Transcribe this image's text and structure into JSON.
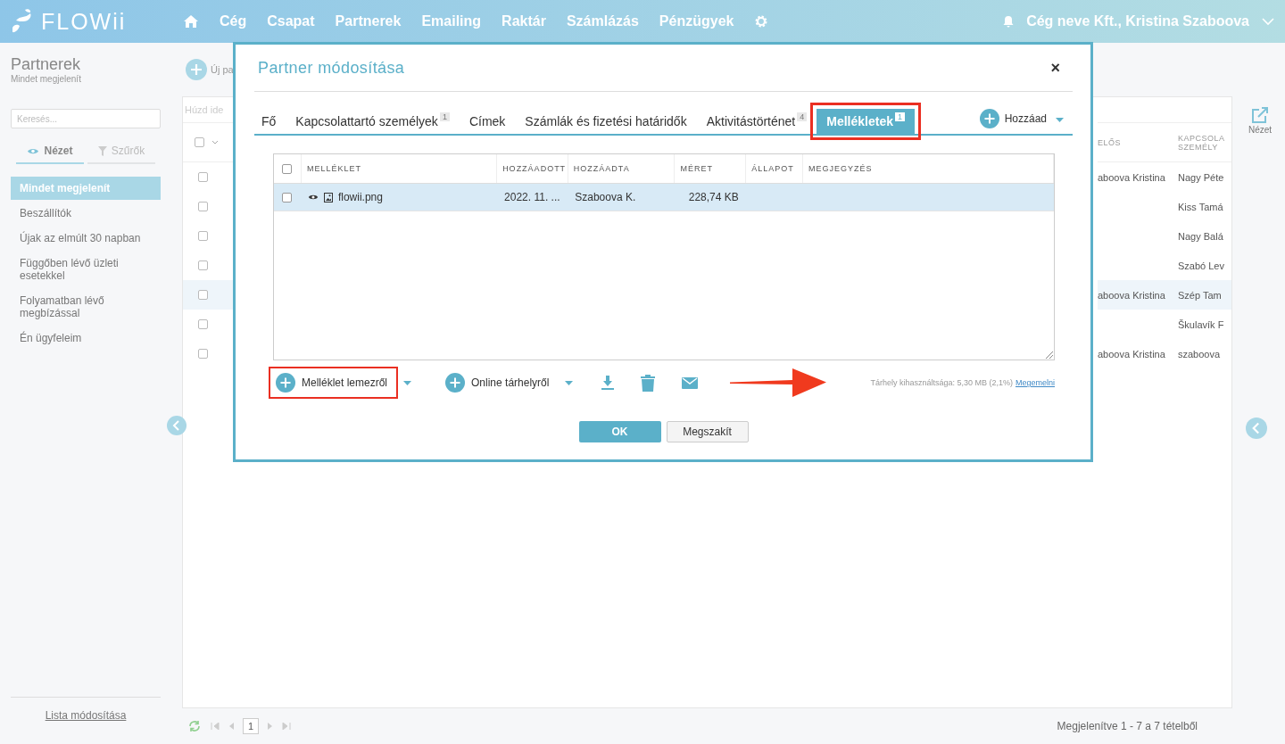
{
  "header": {
    "logo": "FLOWii",
    "nav": [
      "Cég",
      "Csapat",
      "Partnerek",
      "Emailing",
      "Raktár",
      "Számlázás",
      "Pénzügyek"
    ],
    "user": "Cég neve Kft., Kristina Szaboova"
  },
  "sidebar": {
    "title": "Partnerek",
    "subtitle": "Mindet megjelenít",
    "search": {
      "placeholder": "Keresés..."
    },
    "tabs": [
      {
        "label": "Nézet",
        "kind": "view",
        "selected": true
      },
      {
        "label": "Szűrők",
        "kind": "filter",
        "selected": false
      }
    ],
    "items": [
      {
        "label": "Mindet megjelenít",
        "selected": true
      },
      {
        "label": "Beszállítók",
        "selected": false
      },
      {
        "label": "Újak az elmúlt 30 napban",
        "selected": false
      },
      {
        "label": "Függőben lévő üzleti esetekkel",
        "selected": false
      },
      {
        "label": "Folyamatban lévő megbízással",
        "selected": false
      },
      {
        "label": "Én ügyfeleim",
        "selected": false
      }
    ],
    "footer_link": "Lista módosítása"
  },
  "toolbar": {
    "new_button": "Új pa"
  },
  "grid": {
    "group_hint": "Húzd ide",
    "select_all": {
      "checked": false
    },
    "columns": [
      "ELŐS",
      "KAPCSOLA SZEMÉLY"
    ],
    "rows": [
      {
        "checked": false,
        "selected": false,
        "cells": [
          "aboova Kristina",
          "Nagy Péte"
        ]
      },
      {
        "checked": false,
        "selected": false,
        "cells": [
          "",
          "Kiss Tamá"
        ]
      },
      {
        "checked": false,
        "selected": false,
        "cells": [
          "",
          "Nagy Balá"
        ]
      },
      {
        "checked": false,
        "selected": false,
        "cells": [
          "",
          "Szabó Lev"
        ]
      },
      {
        "checked": false,
        "selected": true,
        "cells": [
          "aboova Kristina",
          "Szép Tam"
        ]
      },
      {
        "checked": false,
        "selected": false,
        "cells": [
          "",
          "Škulavík F"
        ]
      },
      {
        "checked": false,
        "selected": false,
        "cells": [
          "aboova Kristina",
          "szaboova"
        ]
      }
    ]
  },
  "right_panel": {
    "view_label": "Nézet"
  },
  "pager": {
    "page": "1",
    "summary": "Megjelenítve 1 - 7 a 7 tételből"
  },
  "dialog": {
    "title": "Partner módosítása",
    "close": "×",
    "tabs": [
      {
        "label": "Fő",
        "selected": false,
        "highlighted": false
      },
      {
        "label": "Kapcsolattartó személyek",
        "badge": "1",
        "selected": false,
        "highlighted": false
      },
      {
        "label": "Címek",
        "selected": false,
        "highlighted": false
      },
      {
        "label": "Számlák és fizetési határidők",
        "selected": false,
        "highlighted": false
      },
      {
        "label": "Aktivitástörténet",
        "badge": "4",
        "selected": false,
        "highlighted": false
      },
      {
        "label": "Mellékletek",
        "badge": "1",
        "selected": true,
        "highlighted": true
      }
    ],
    "add_button": "Hozzáad",
    "table": {
      "select_all": {
        "checked": false
      },
      "columns": [
        "MELLÉKLET",
        "HOZZÁADOTT",
        "HOZZÁADTA",
        "MÉRET",
        "ÁLLAPOT",
        "MEGJEGYZÉS"
      ],
      "rows": [
        {
          "checked": false,
          "selected": true,
          "cells": [
            "flowii.png",
            "2022. 11. ...",
            "Szaboova K.",
            "228,74 KB",
            "",
            ""
          ]
        }
      ]
    },
    "actions": [
      {
        "label": "Melléklet lemezről",
        "highlighted": true
      },
      {
        "label": "Online tárhelyről",
        "highlighted": false
      }
    ],
    "storage": {
      "text": "Tárhely kihasználtsága: 5,30 MB (2,1%)",
      "link": "Megemelni"
    },
    "ok": "OK",
    "cancel": "Megszakít"
  }
}
